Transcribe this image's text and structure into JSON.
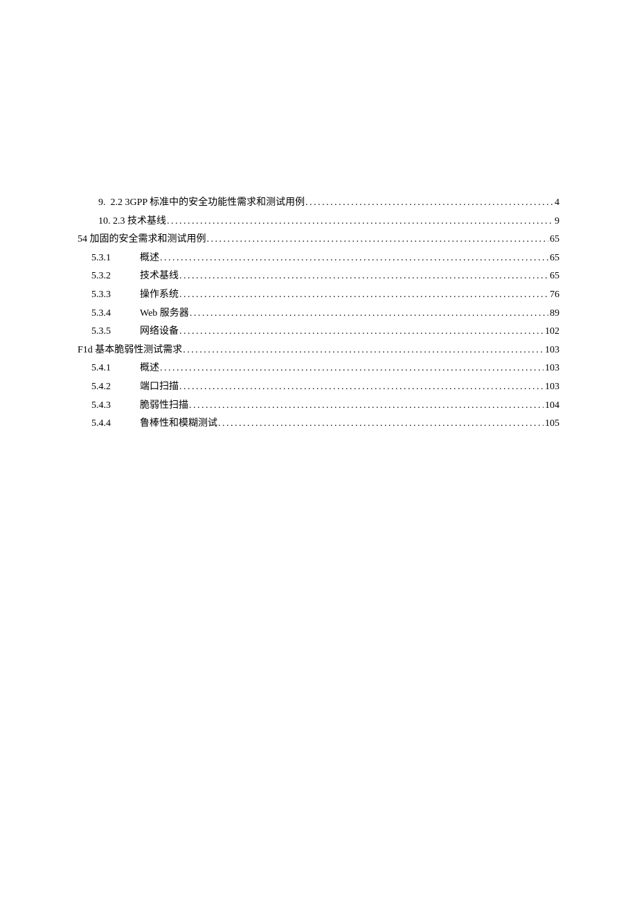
{
  "toc": {
    "entries": [
      {
        "indent": "indent-1",
        "prefix": "9.  ",
        "title": "2.2  3GPP 标准中的安全功能性需求和测试用例 ",
        "page": "4"
      },
      {
        "indent": "indent-1",
        "prefix": "10. ",
        "title": "2.3 技术基线",
        "page": "9"
      },
      {
        "indent": "indent-0",
        "prefix": "",
        "title": "54 加固的安全需求和测试用例",
        "page": "65"
      },
      {
        "indent": "indent-2-a",
        "prefix": "5.3.1",
        "title": "概述",
        "page": "65"
      },
      {
        "indent": "indent-2-a",
        "prefix": "5.3.2",
        "title": "技术基线",
        "page": "65"
      },
      {
        "indent": "indent-2-a",
        "prefix": "5.3.3",
        "title": "操作系统",
        "page": "76"
      },
      {
        "indent": "indent-2-a",
        "prefix": "5.3.4",
        "title": "Web 服务器 ",
        "page": "89"
      },
      {
        "indent": "indent-2-a",
        "prefix": "5.3.5",
        "title": "网络设备",
        "page": "102"
      },
      {
        "indent": "indent-0",
        "prefix": "",
        "title": "F1d 基本脆弱性测试需求 ",
        "page": "103"
      },
      {
        "indent": "indent-2-b",
        "prefix": "5.4.1",
        "title": "概述",
        "page": "103"
      },
      {
        "indent": "indent-2-b",
        "prefix": "5.4.2",
        "title": "端口扫描",
        "page": "103"
      },
      {
        "indent": "indent-2-b",
        "prefix": "5.4.3",
        "title": "脆弱性扫描",
        "page": "104"
      },
      {
        "indent": "indent-2-b",
        "prefix": "5.4.4",
        "title": "鲁棒性和模糊测试",
        "page": "105"
      }
    ]
  }
}
